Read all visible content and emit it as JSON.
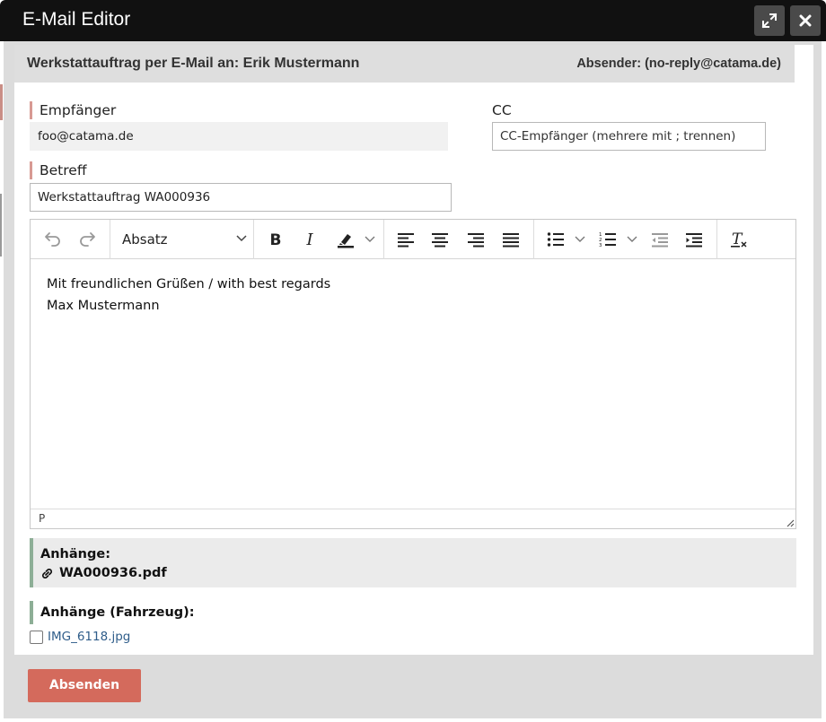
{
  "window": {
    "title": "E-Mail Editor",
    "expand_icon": "expand-arrows-icon",
    "close_icon": "close-x-icon"
  },
  "header": {
    "title": "Werkstattauftrag per E-Mail an: Erik Mustermann",
    "sender": "Absender: (no-reply@catama.de)"
  },
  "form": {
    "recipient_label": "Empfänger",
    "recipient_value": "foo@catama.de",
    "cc_label": "CC",
    "cc_placeholder": "CC-Empfänger (mehrere mit ; trennen)",
    "subject_label": "Betreff",
    "subject_value": "Werkstattauftrag WA000936"
  },
  "editor": {
    "block_format": "Absatz",
    "body_lines": [
      "Mit freundlichen Grüßen / with best regards",
      "Max Mustermann"
    ],
    "status_path": "P",
    "toolbar_icons": [
      "undo-icon",
      "redo-icon",
      "bold-icon",
      "italic-icon",
      "highlight-icon",
      "align-left-icon",
      "align-center-icon",
      "align-right-icon",
      "align-justify-icon",
      "bullet-list-icon",
      "numbered-list-icon",
      "outdent-icon",
      "indent-icon",
      "clear-format-icon"
    ]
  },
  "attachments": {
    "label": "Anhänge:",
    "file": "WA000936.pdf",
    "file_icon": "link-icon"
  },
  "vehicle_attachments": {
    "label": "Anhänge (Fahrzeug):",
    "file": "IMG_6118.jpg"
  },
  "actions": {
    "send_label": "Absenden"
  },
  "colors": {
    "titlebar": "#111111",
    "send_button": "#d46a5c",
    "required_marker": "#d89a93",
    "attachment_marker": "#8dae96",
    "link": "#2f5d8a"
  }
}
